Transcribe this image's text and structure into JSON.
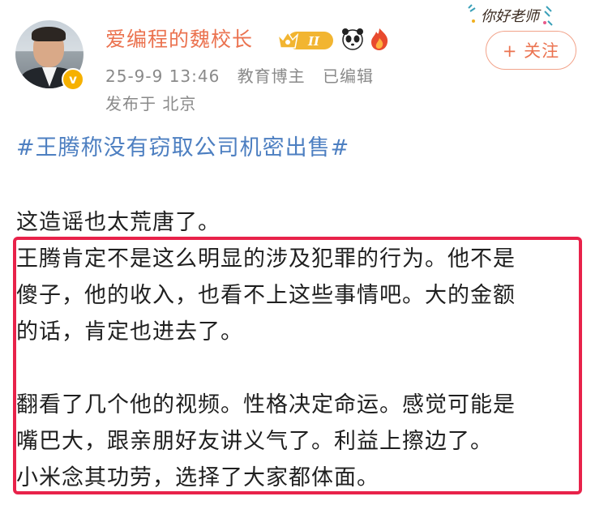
{
  "author": {
    "name": "爱编程的魏校长",
    "level_badge": "II",
    "timestamp": "25-9-9 13:46",
    "role": "教育博主",
    "edited": "已编辑",
    "location": "发布于 北京",
    "verified_mark": "v"
  },
  "sticker": {
    "text": "你好老师"
  },
  "follow_button": {
    "label": "+ 关注"
  },
  "post": {
    "topic": "#王腾称没有窃取公司机密出售#",
    "lines": [
      "这造谣也太荒唐了。",
      "王腾肯定不是这么明显的涉及犯罪的行为。他不是",
      "傻子，他的收入，也看不上这些事情吧。大的金额",
      "的话，肯定也进去了。",
      "",
      "翻看了几个他的视频。性格决定命运。感觉可能是",
      "嘴巴大，跟亲朋好友讲义气了。利益上擦边了。",
      "小米念其功劳，选择了大家都体面。"
    ]
  },
  "colors": {
    "username": "#eb7350",
    "topic": "#4d7fc1",
    "highlight_box": "#e8224a",
    "meta": "#8a8a8a"
  },
  "icons": [
    "verified-badge-icon",
    "crown-level-badge-icon",
    "panda-icon",
    "fire-icon"
  ]
}
